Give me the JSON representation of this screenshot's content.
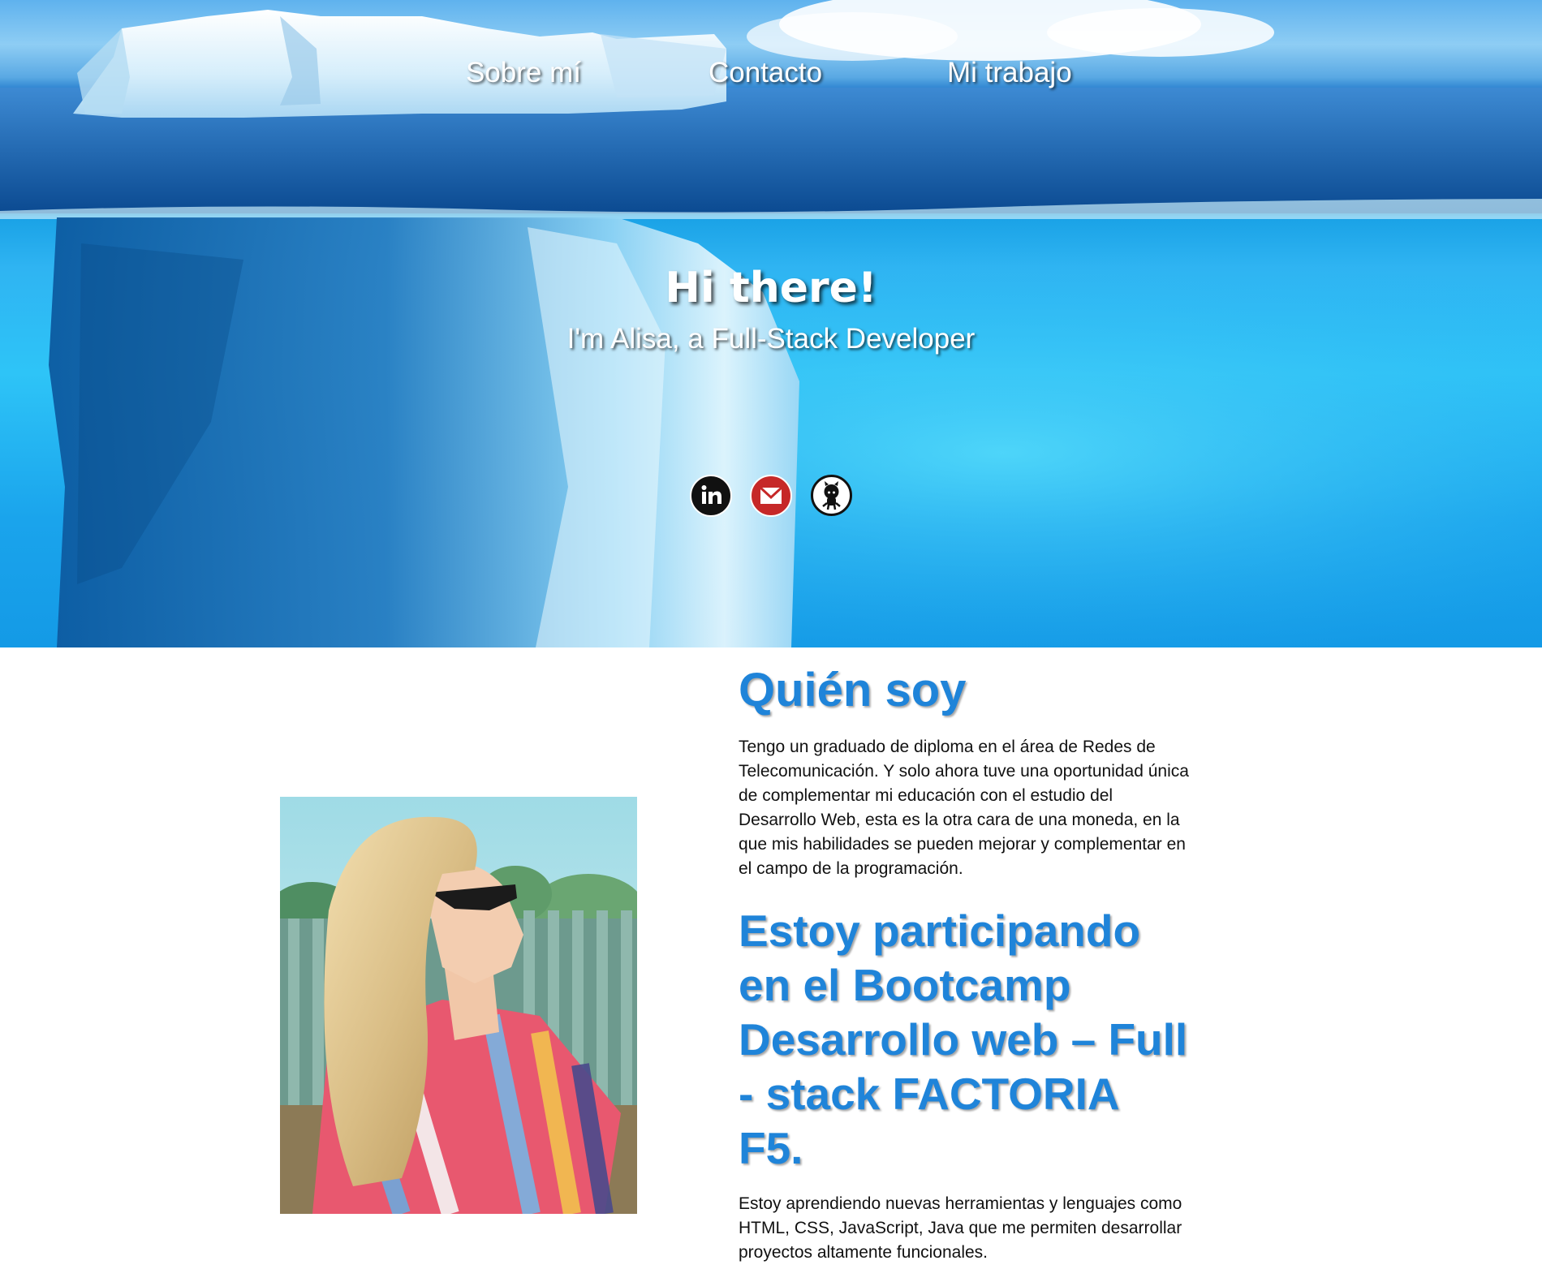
{
  "nav": {
    "items": [
      {
        "label": "Sobre mí"
      },
      {
        "label": "Contacto"
      },
      {
        "label": "Mi trabajo"
      }
    ]
  },
  "hero": {
    "title": "Hi there!",
    "subtitle": "I'm Alisa, a Full-Stack Developer"
  },
  "socials": [
    {
      "icon": "linkedin-icon",
      "color": "#111111"
    },
    {
      "icon": "gmail-icon",
      "color": "#c62828"
    },
    {
      "icon": "github-icon",
      "color": "#ffffff"
    }
  ],
  "about": {
    "heading": "Quién soy",
    "paragraph": "Tengo un graduado de diploma en el área de Redes de Telecomunicación. Y solo ahora tuve una oportunidad única de complementar mi educación con el estudio del Desarrollo Web, esta es la otra cara de una moneda, en la que mis habilidades se pueden mejorar y complementar en el campo de la programación.",
    "bootcamp_heading": "Estoy participando en el Bootcamp Desarrollo web – Full - stack FACTORIA F5.",
    "bootcamp_paragraph": "Estoy aprendiendo nuevas herramientas y lenguajes como HTML, CSS, JavaScript, Java que me permiten desarrollar proyectos altamente funcionales."
  },
  "colors": {
    "heading": "#1f84d9",
    "ocean": "#2fb4f2"
  }
}
